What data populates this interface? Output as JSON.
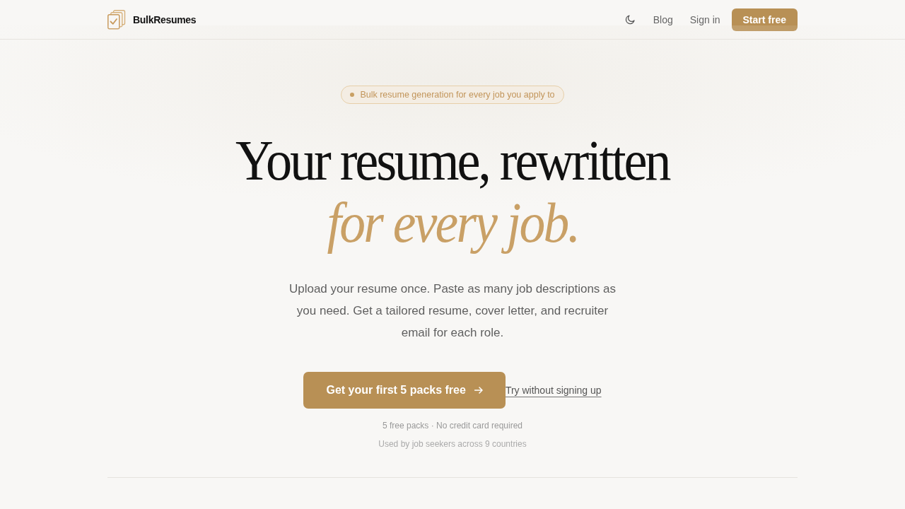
{
  "header": {
    "brand": "BulkResumes",
    "nav_links": [
      "Blog",
      "Sign in"
    ],
    "cta": "Start free"
  },
  "hero": {
    "badge": "Bulk resume generation for every job you apply to",
    "headline": "Your resume, rewritten",
    "headline_accent": "for every job.",
    "description": "Upload your resume once. Paste as many job descriptions as you need. Get a tailored resume, cover letter, and recruiter email for each role.",
    "primary_button": "Get your first 5 packs free",
    "secondary_link": "Try without signing up",
    "note": "5 free packs · No credit card required",
    "social_proof": "Used by job seekers across 9 countries"
  }
}
